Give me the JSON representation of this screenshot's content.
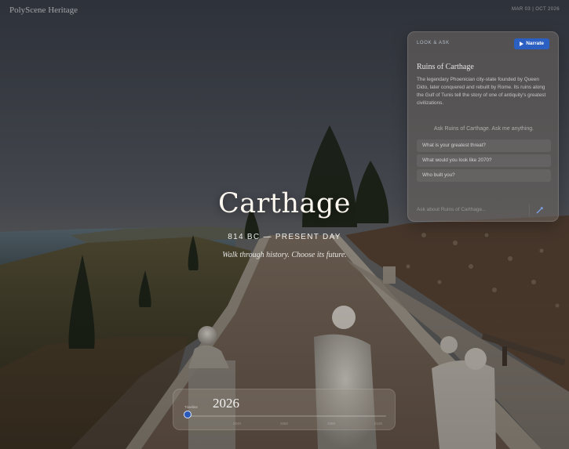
{
  "header": {
    "brand": "PolyScene Heritage",
    "right_label": "MAR 03 | OCT 2026"
  },
  "hero": {
    "title": "Carthage",
    "period": "814 BC — PRESENT DAY",
    "tagline": "Walk through history. Choose its future."
  },
  "panel": {
    "tag": "LOOK & ASK",
    "narrate_label": "Narrate",
    "title": "Ruins of Carthage",
    "description": "The legendary Phoenician city-state founded by Queen Dido, later conquered and rebuilt by Rome. Its ruins along the Gulf of Tunis tell the story of one of antiquity's greatest civilizations.",
    "ask_hint": "Ask Ruins of Carthage. Ask me anything.",
    "suggestions": [
      "What is your greatest threat?",
      "What would you look like 2070?",
      "Who built you?"
    ],
    "input_placeholder": "Ask about Ruins of Carthage..."
  },
  "timeline": {
    "label": "Timeline",
    "year": "2026",
    "ticks": [
      "2040",
      "2060",
      "2080",
      "2100"
    ],
    "progress": 0.0
  },
  "icons": {
    "play": "play-icon",
    "send": "send-icon"
  },
  "colors": {
    "accent": "#2b5fc2",
    "thumb": "#2a59b8"
  }
}
